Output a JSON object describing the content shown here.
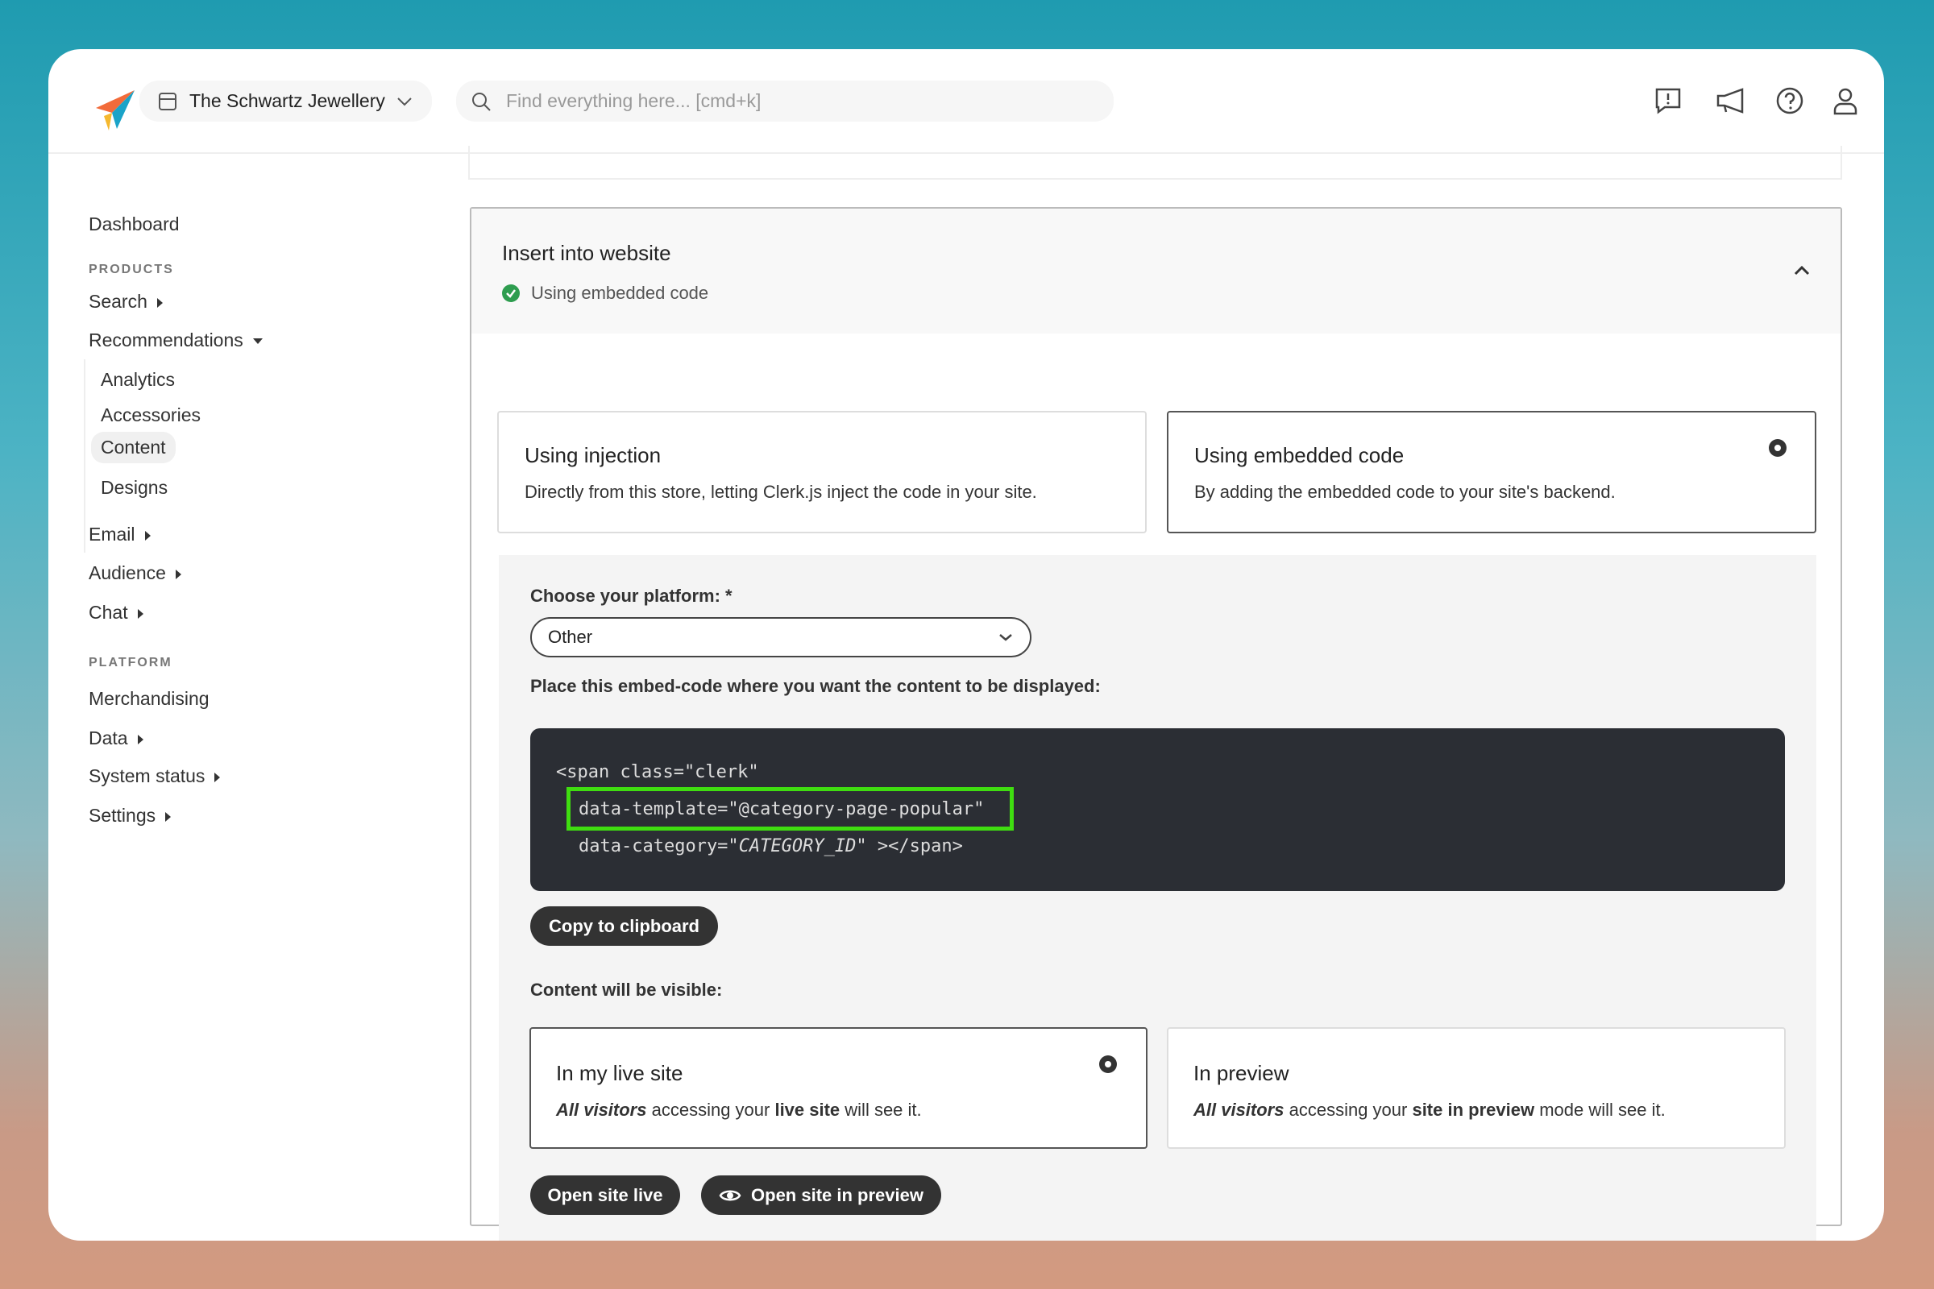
{
  "header": {
    "store_name": "The Schwartz Jewellery",
    "search_placeholder": "Find everything here... [cmd+k]",
    "icons": [
      "feedback-icon",
      "announcement-icon",
      "help-icon",
      "user-icon"
    ]
  },
  "sidebar": {
    "dashboard": "Dashboard",
    "products_heading": "PRODUCTS",
    "search": "Search",
    "recommendations": "Recommendations",
    "rec_items": [
      "Analytics",
      "Accessories",
      "Content",
      "Designs"
    ],
    "email": "Email",
    "audience": "Audience",
    "chat": "Chat",
    "platform_heading": "PLATFORM",
    "merchandising": "Merchandising",
    "data": "Data",
    "system_status": "System status",
    "settings": "Settings"
  },
  "panel": {
    "title": "Insert into website",
    "status": "Using embedded code",
    "status_color": "#2e9d4f",
    "options": [
      {
        "title": "Using injection",
        "desc": "Directly from this store, letting Clerk.js inject the code in your site."
      },
      {
        "title": "Using embedded code",
        "desc": "By adding the embedded code to your site's backend.",
        "selected": true
      }
    ],
    "platform_label": "Choose your platform: *",
    "platform_value": "Other",
    "embed_label": "Place this embed-code where you want the content to be displayed:",
    "code": {
      "line1": "<span class=\"clerk\"",
      "line2": "data-template=\"@category-page-popular\"",
      "line3_a": "data-category=\"",
      "line3_b": "CATEGORY_ID",
      "line3_c": "\" ></span>"
    },
    "highlight_color": "#3fdd10",
    "copy_button": "Copy to clipboard",
    "visible_label": "Content will be visible:",
    "visibility": [
      {
        "title": "In my live site",
        "a": "All visitors",
        "b": " accessing your ",
        "c": "live site",
        "d": " will see it.",
        "selected": true
      },
      {
        "title": "In preview",
        "a": "All visitors",
        "b": " accessing your ",
        "c": "site in preview",
        "d": " mode will see it."
      }
    ],
    "open_live": "Open site live",
    "open_preview": "Open site in preview"
  }
}
